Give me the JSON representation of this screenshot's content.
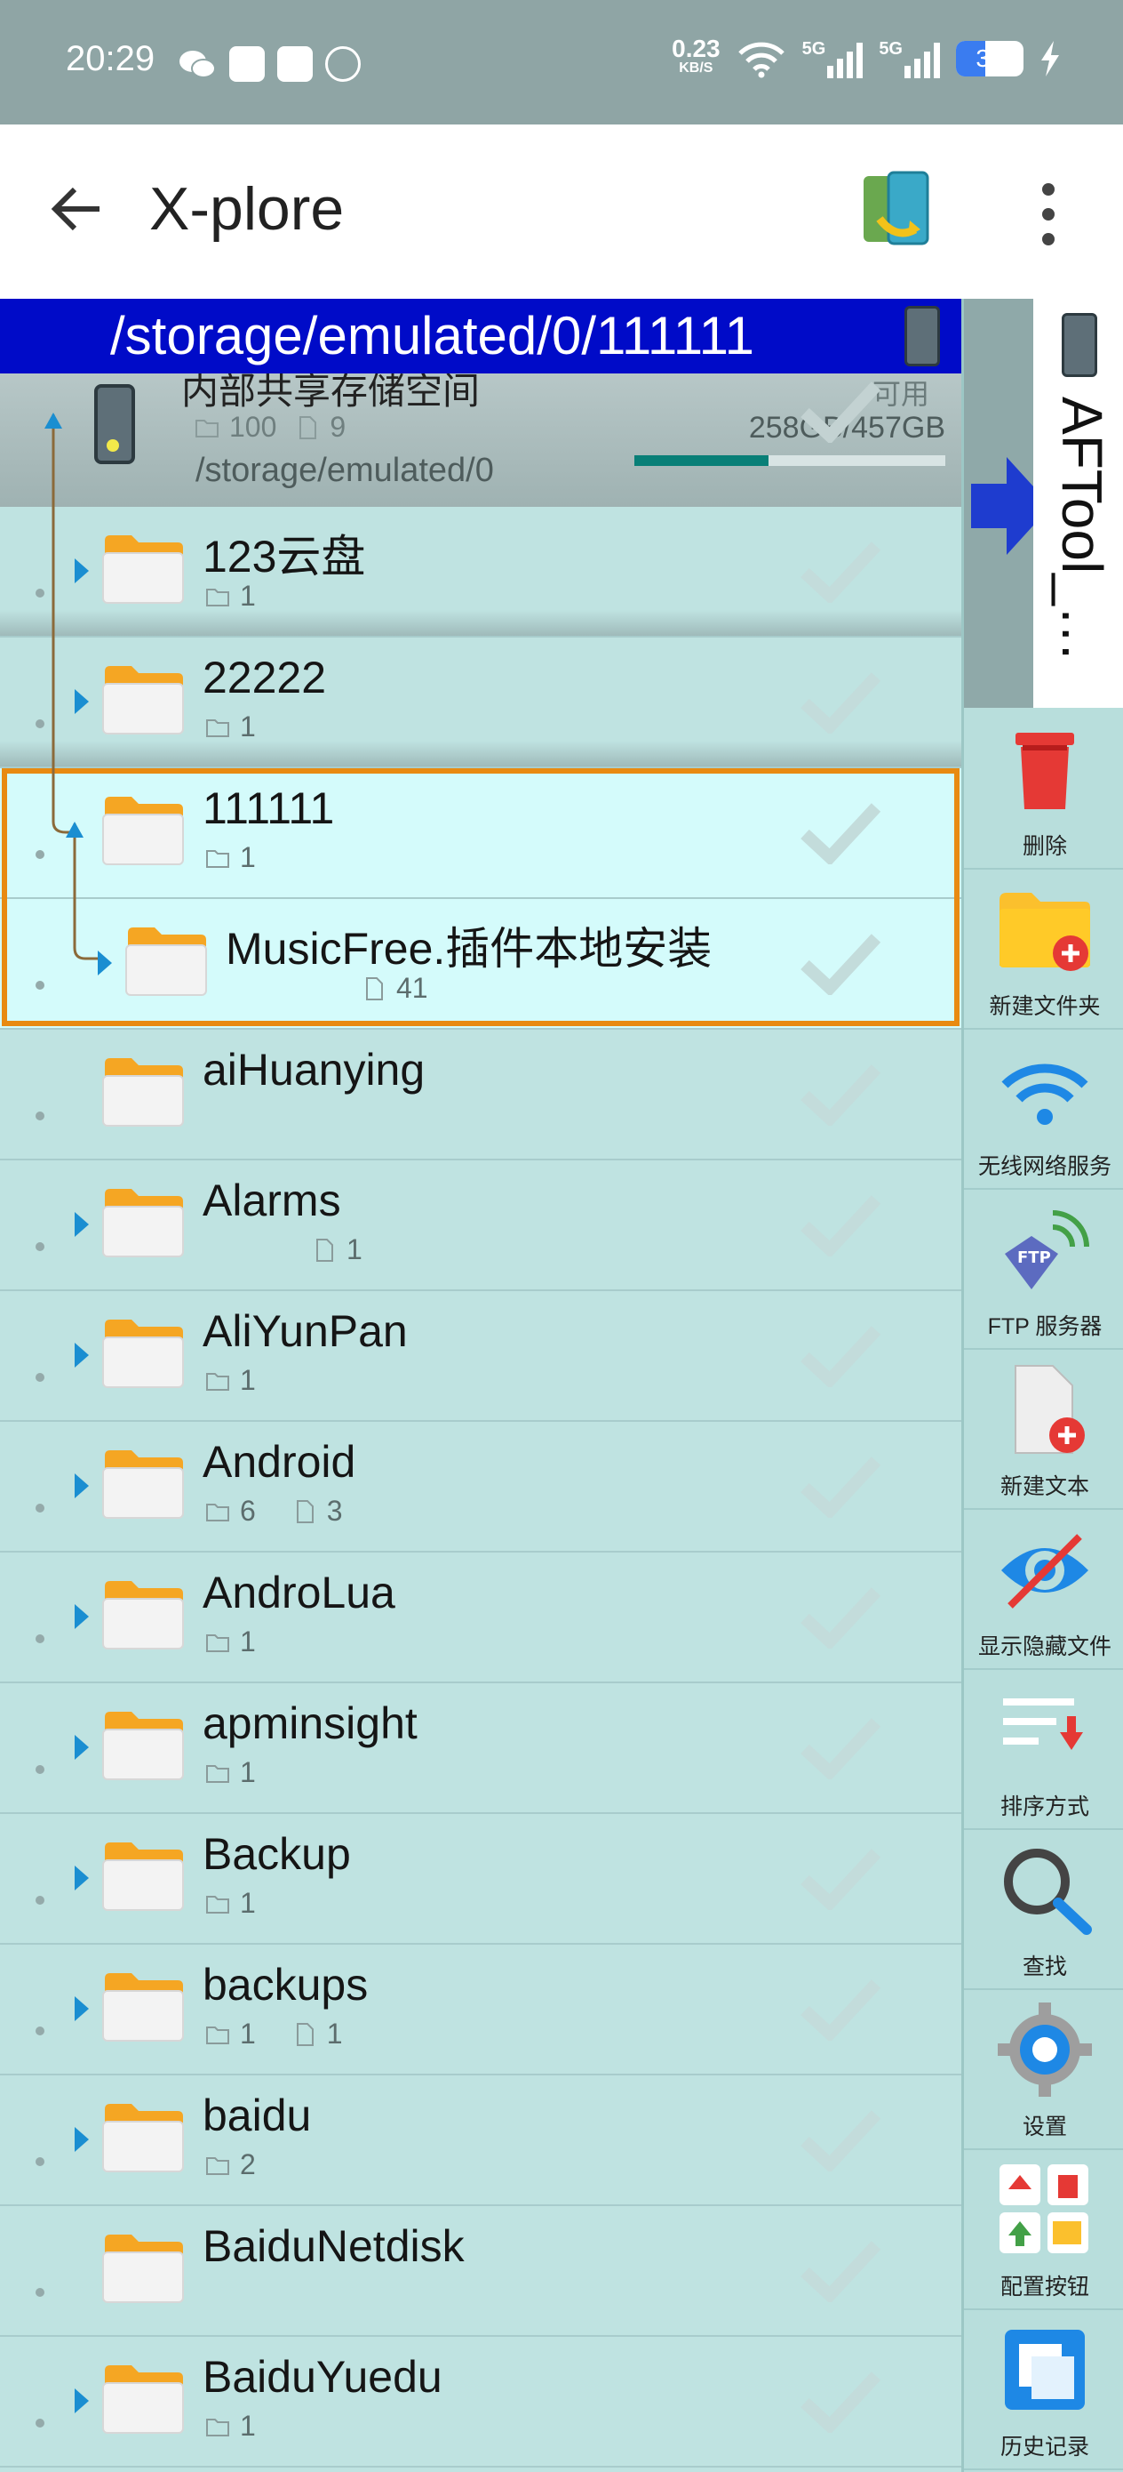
{
  "status_bar": {
    "time": "20:29",
    "net_speed": "0.23",
    "net_unit": "KB/S",
    "sig1": "5G",
    "sig2": "5G",
    "battery": "34"
  },
  "app_bar": {
    "title": "X-plore"
  },
  "path_bar": {
    "path": "/storage/emulated/0/111111"
  },
  "storage": {
    "name": "内部共享存储空间",
    "available_label": "可用",
    "folders": "100",
    "files": "9",
    "size": "258GB/457GB",
    "path": "/storage/emulated/0",
    "used_fraction": 0.43
  },
  "rows": [
    {
      "name": "123云盘",
      "folders": "1",
      "files": ""
    },
    {
      "name": "22222",
      "folders": "1",
      "files": ""
    },
    {
      "name": "111111",
      "folders": "1",
      "files": ""
    },
    {
      "name": "MusicFree.插件本地安装",
      "folders": "",
      "files": "41"
    },
    {
      "name": "aiHuanying",
      "folders": "",
      "files": ""
    },
    {
      "name": "Alarms",
      "folders": "",
      "files": "1"
    },
    {
      "name": "AliYunPan",
      "folders": "1",
      "files": ""
    },
    {
      "name": "Android",
      "folders": "6",
      "files": "3"
    },
    {
      "name": "AndroLua",
      "folders": "1",
      "files": ""
    },
    {
      "name": "apminsight",
      "folders": "1",
      "files": ""
    },
    {
      "name": "Backup",
      "folders": "1",
      "files": ""
    },
    {
      "name": "backups",
      "folders": "1",
      "files": "1"
    },
    {
      "name": "baidu",
      "folders": "2",
      "files": ""
    },
    {
      "name": "BaiduNetdisk",
      "folders": "",
      "files": ""
    },
    {
      "name": "BaiduYuedu",
      "folders": "1",
      "files": ""
    }
  ],
  "side_panel": {
    "tab_label": "AFTool_…",
    "tools": [
      {
        "label": "删除",
        "icon": "trash-icon"
      },
      {
        "label": "新建文件夹",
        "icon": "new-folder-icon"
      },
      {
        "label": "无线网络服务",
        "icon": "wifi-icon"
      },
      {
        "label": "FTP 服务器",
        "icon": "ftp-icon"
      },
      {
        "label": "新建文本",
        "icon": "new-text-icon"
      },
      {
        "label": "显示隐藏文件",
        "icon": "hidden-files-icon"
      },
      {
        "label": "排序方式",
        "icon": "sort-icon"
      },
      {
        "label": "查找",
        "icon": "search-icon"
      },
      {
        "label": "设置",
        "icon": "settings-icon"
      },
      {
        "label": "配置按钮",
        "icon": "configure-buttons-icon"
      },
      {
        "label": "历史记录",
        "icon": "history-icon"
      }
    ]
  }
}
